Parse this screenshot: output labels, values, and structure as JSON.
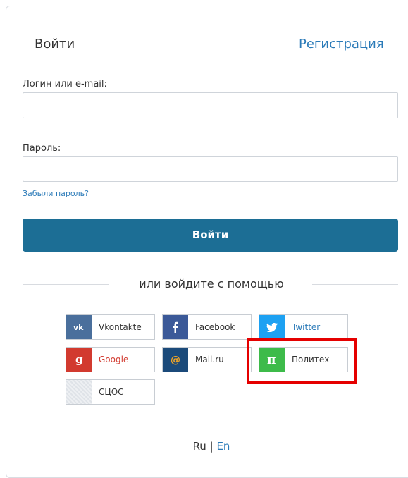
{
  "tabs": {
    "login": "Войти",
    "register": "Регистрация"
  },
  "form": {
    "login_label": "Логин или e-mail:",
    "login_value": "",
    "password_label": "Пароль:",
    "password_value": "",
    "forgot": "Забыли пароль?",
    "submit": "Войти"
  },
  "divider": "или войдите с помощью",
  "social": [
    {
      "label": "Vkontakte",
      "icon": "vk-icon",
      "color": "#4a6f9c"
    },
    {
      "label": "Facebook",
      "icon": "facebook-icon",
      "color": "#3b5998"
    },
    {
      "label": "Twitter",
      "icon": "twitter-icon",
      "color": "#1da1f2"
    },
    {
      "label": "Google",
      "icon": "google-icon",
      "color": "#d23a2f"
    },
    {
      "label": "Mail.ru",
      "icon": "mailru-icon",
      "color": "#1b4a7a"
    },
    {
      "label": "Политех",
      "icon": "pi-icon",
      "color": "#3dbb4a"
    },
    {
      "label": "СЦОС",
      "icon": "scos-icon",
      "color": "#e8eaee"
    }
  ],
  "lang": {
    "ru": "Ru",
    "sep": "|",
    "en": "En"
  }
}
